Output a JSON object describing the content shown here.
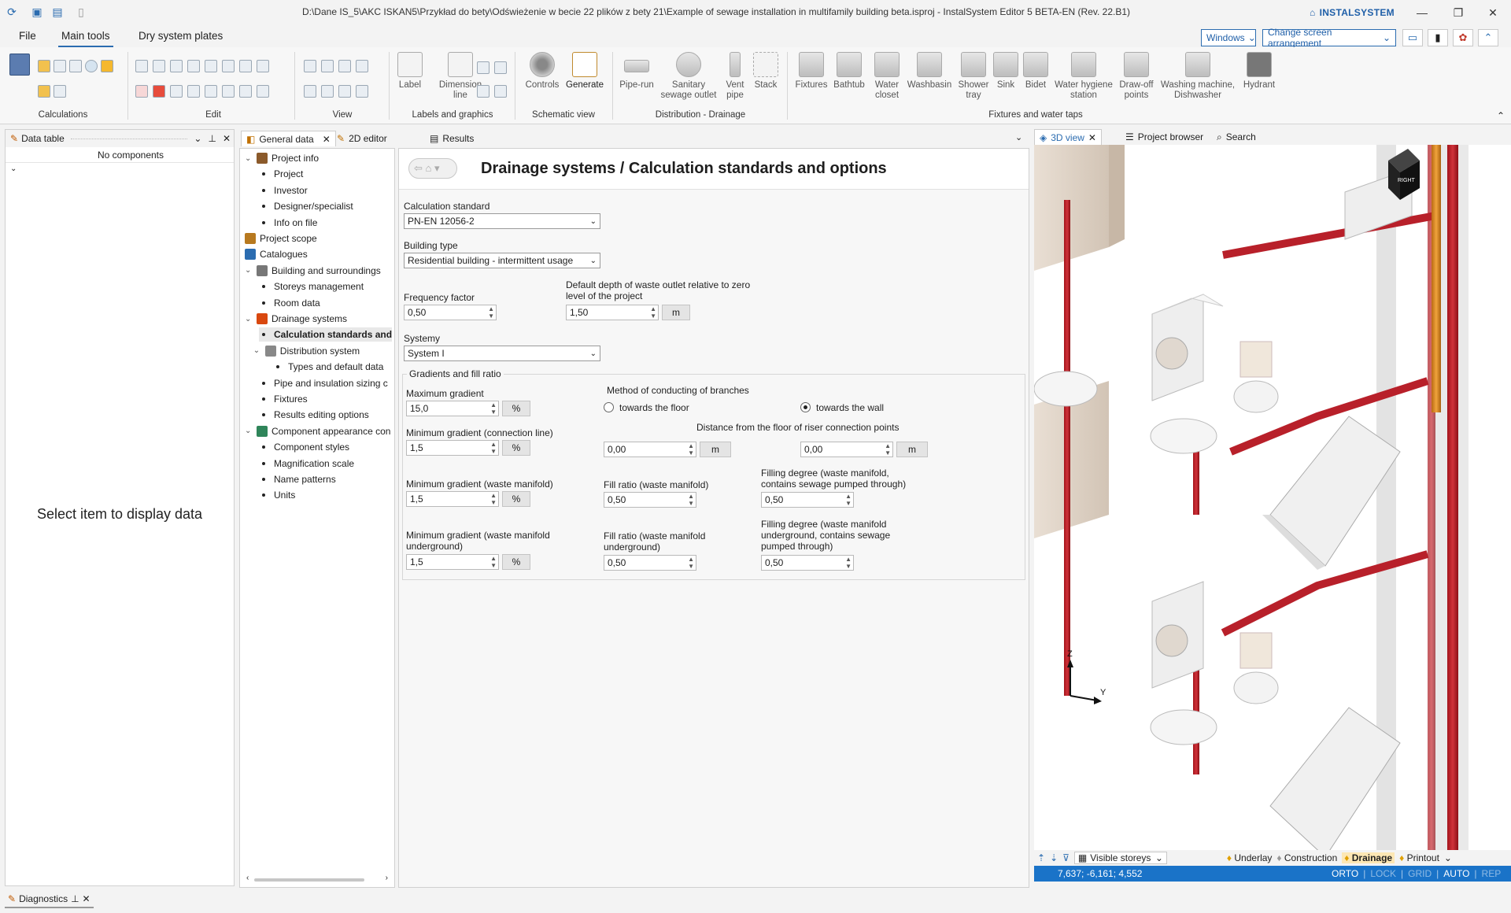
{
  "titlebar": {
    "title": "D:\\Dane IS_5\\AKC ISKAN5\\Przykład do bety\\Odświeżenie w becie 22 plików z bety 21\\Example of sewage installation in multifamily building beta.isproj - InstalSystem Editor 5 BETA-EN (Rev. 22.B1)",
    "brand": "INSTALSYSTEM"
  },
  "menu": {
    "tabs": [
      "File",
      "Main tools",
      "Dry system plates"
    ],
    "windows": "Windows",
    "arrangement": "Change screen arrangement"
  },
  "ribbon": {
    "groups": [
      "Calculations",
      "Edit",
      "Labels and graphics",
      "View",
      "Schematic view",
      "Distribution - Drainage",
      "Fixtures and water taps"
    ],
    "labels_graphics": [
      "Label",
      "Dimension line"
    ],
    "schematic": [
      "Controls",
      "Generate"
    ],
    "distribution": [
      "Pipe-run",
      "Sanitary sewage outlet",
      "Vent pipe",
      "Stack"
    ],
    "fixtures": [
      "Fixtures",
      "Bathtub",
      "Water closet",
      "Washbasin",
      "Shower tray",
      "Sink",
      "Bidet",
      "Water hygiene station",
      "Draw-off points",
      "Washing machine, Dishwasher",
      "Hydrant"
    ]
  },
  "datatable": {
    "title": "Data table",
    "no_components": "No components",
    "empty": "Select item to display data"
  },
  "center_tabs": [
    "General data",
    "2D editor",
    "Results"
  ],
  "tree": [
    {
      "label": "Project info",
      "level": 0,
      "toggle": "⌄"
    },
    {
      "label": "Project",
      "level": 1
    },
    {
      "label": "Investor",
      "level": 1
    },
    {
      "label": "Designer/specialist",
      "level": 1
    },
    {
      "label": "Info on file",
      "level": 1
    },
    {
      "label": "Project scope",
      "level": 0
    },
    {
      "label": "Catalogues",
      "level": 0
    },
    {
      "label": "Building and surroundings",
      "level": 0,
      "toggle": "⌄"
    },
    {
      "label": "Storeys management",
      "level": 1
    },
    {
      "label": "Room data",
      "level": 1
    },
    {
      "label": "Drainage systems",
      "level": 0,
      "toggle": "⌄"
    },
    {
      "label": "Calculation standards and",
      "level": 1,
      "selected": true
    },
    {
      "label": "Distribution system",
      "level": 0.6,
      "toggle": "⌄"
    },
    {
      "label": "Types and default data",
      "level": 2
    },
    {
      "label": "Pipe and insulation sizing c",
      "level": 1
    },
    {
      "label": "Fixtures",
      "level": 1
    },
    {
      "label": "Results editing options",
      "level": 1
    },
    {
      "label": "Component appearance con",
      "level": 0,
      "toggle": "⌄"
    },
    {
      "label": "Component styles",
      "level": 1
    },
    {
      "label": "Magnification scale",
      "level": 1
    },
    {
      "label": "Name patterns",
      "level": 1
    },
    {
      "label": "Units",
      "level": 1
    }
  ],
  "form": {
    "heading": "Drainage systems / Calculation standards and options",
    "calc_standard_label": "Calculation standard",
    "calc_standard": "PN-EN 12056-2",
    "building_type_label": "Building type",
    "building_type": "Residential building - intermittent usage",
    "frequency_label": "Frequency factor",
    "frequency": "0,50",
    "depth_label": "Default depth of waste outlet relative to zero level of the project",
    "depth": "1,50",
    "unit_m": "m",
    "systemy_label": "Systemy",
    "systemy": "System I",
    "group_title": "Gradients and fill ratio",
    "max_gradient_label": "Maximum gradient",
    "max_gradient": "15,0",
    "unit_pct": "%",
    "min_grad_conn_label": "Minimum gradient (connection line)",
    "min_grad_conn": "1,5",
    "min_grad_manifold_label": "Minimum gradient (waste manifold)",
    "min_grad_manifold": "1,5",
    "min_grad_under_label": "Minimum gradient (waste manifold underground)",
    "min_grad_under": "1,5",
    "method_label": "Method of conducting of branches",
    "opt_floor": "towards the floor",
    "opt_wall": "towards the wall",
    "distance_label": "Distance from the floor of riser connection points",
    "dist1": "0,00",
    "dist2": "0,00",
    "fill_manifold_label": "Fill ratio (waste manifold)",
    "fill_manifold": "0,50",
    "fill_under_label": "Fill ratio (waste manifold underground)",
    "fill_under": "0,50",
    "filling_manifold_label": "Filling degree (waste manifold, contains sewage pumped through)",
    "filling_manifold": "0,50",
    "filling_under_label": "Filling degree (waste manifold underground, contains sewage pumped through)",
    "filling_under": "0,50"
  },
  "right_tabs": [
    "3D view",
    "Project browser",
    "Search"
  ],
  "view3d": {
    "cube": "RIGHT",
    "axis_z": "Z",
    "axis_y": "Y",
    "visible_storeys": "Visible storeys",
    "layers": [
      "Underlay",
      "Construction",
      "Drainage",
      "Printout"
    ]
  },
  "status": {
    "coords": "7,637; -6,161; 4,552",
    "flags": [
      "ORTO",
      "LOCK",
      "GRID",
      "AUTO",
      "REP"
    ]
  },
  "diagnostics": "Diagnostics"
}
